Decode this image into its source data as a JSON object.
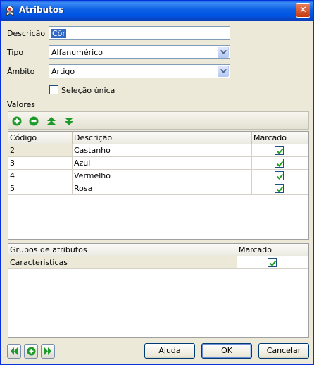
{
  "window": {
    "title": "Atributos",
    "close_glyph": "✕"
  },
  "form": {
    "descricao_label": "Descrição",
    "descricao_value": "Côr",
    "tipo_label": "Tipo",
    "tipo_value": "Alfanumérico",
    "ambito_label": "Âmbito",
    "ambito_value": "Artigo",
    "selecao_label": "Seleção única"
  },
  "valores": {
    "label": "Valores",
    "toolbar": {
      "icons": [
        "add-icon",
        "remove-icon",
        "move-up-icon",
        "move-down-icon"
      ]
    },
    "columns": [
      "Código",
      "Descrição",
      "Marcado"
    ],
    "rows": [
      {
        "codigo": "2",
        "descricao": "Castanho",
        "marcado": true
      },
      {
        "codigo": "3",
        "descricao": "Azul",
        "marcado": true
      },
      {
        "codigo": "4",
        "descricao": "Vermelho",
        "marcado": true
      },
      {
        "codigo": "5",
        "descricao": "Rosa",
        "marcado": true
      }
    ]
  },
  "grupos": {
    "columns": [
      "Grupos de atributos",
      "Marcado"
    ],
    "rows": [
      {
        "nome": "Caracteristicas",
        "marcado": true
      }
    ]
  },
  "footer": {
    "nav_icons": [
      "previous-icon",
      "add-icon",
      "next-icon"
    ],
    "ajuda_label": "Ajuda",
    "ok_label": "OK",
    "cancelar_label": "Cancelar"
  },
  "colors": {
    "titlebar": "#0054e3",
    "dialog_bg": "#ece9d8",
    "check_green": "#21a121",
    "selection": "#316ac5"
  }
}
